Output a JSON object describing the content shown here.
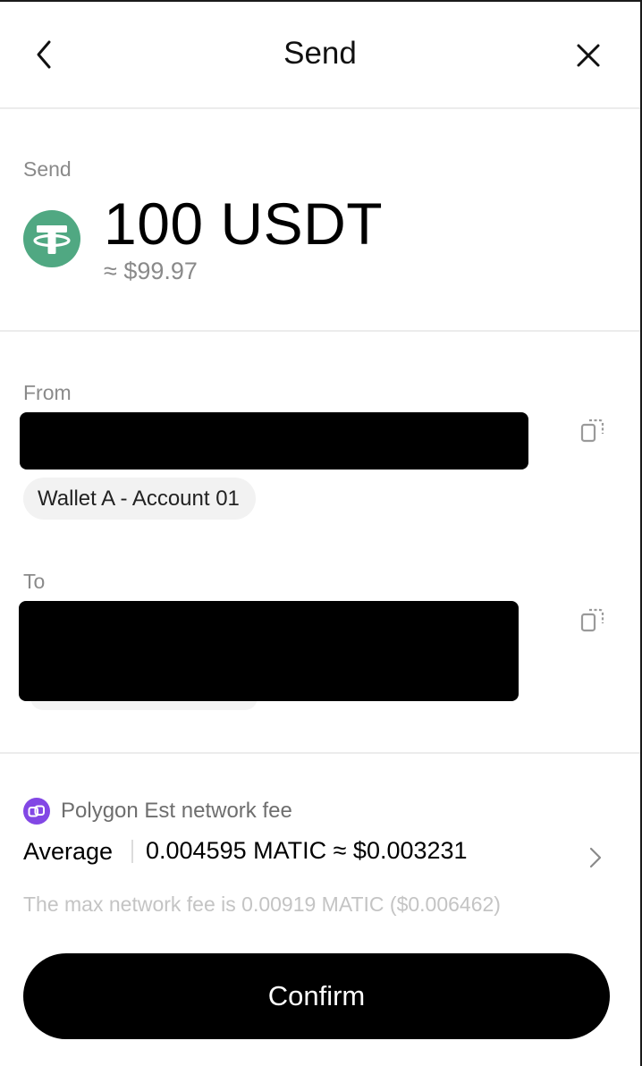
{
  "header": {
    "title": "Send",
    "back_icon": "chevron-left-icon",
    "close_icon": "close-icon"
  },
  "send": {
    "label": "Send",
    "amount": "100 USDT",
    "fiat_estimate": "≈ $99.97",
    "token_icon": "tether-usdt-icon",
    "token_color": "#50a882"
  },
  "from": {
    "label": "From",
    "address_redacted": true,
    "wallet_name": "Wallet A - Account 01",
    "copy_icon": "copy-icon"
  },
  "to": {
    "label": "To",
    "address_redacted": true,
    "copy_icon": "copy-icon"
  },
  "network_fee": {
    "network_icon": "polygon-icon",
    "network_color": "#8247e5",
    "label": "Polygon Est network fee",
    "speed": "Average",
    "fee": "0.004595 MATIC ≈ $0.003231",
    "max_fee_note": "The max network fee is 0.00919 MATIC ($0.006462)",
    "chevron_icon": "chevron-right-icon"
  },
  "confirm_button": {
    "label": "Confirm"
  }
}
